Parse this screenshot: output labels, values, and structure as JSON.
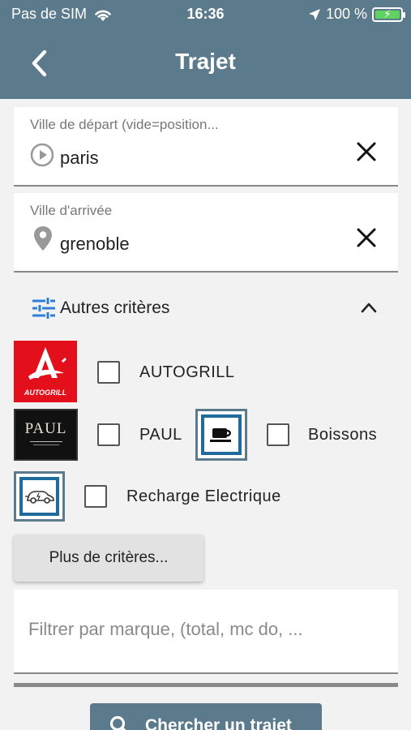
{
  "status_bar": {
    "carrier": "Pas de SIM",
    "time": "16:36",
    "battery": "100 %"
  },
  "header": {
    "title": "Trajet"
  },
  "departure": {
    "label": "Ville de départ (vide=position...",
    "value": "paris"
  },
  "arrival": {
    "label": "Ville d'arrivée",
    "value": "grenoble"
  },
  "criteria": {
    "label": "Autres critères"
  },
  "filters": {
    "autogrill": {
      "label": "AUTOGRILL",
      "logo_text": "AUTOGRILL",
      "checked": false
    },
    "paul": {
      "label": "PAUL",
      "logo_text": "PAUL",
      "checked": false
    },
    "boissons": {
      "label": "Boissons",
      "checked": false
    },
    "recharge": {
      "label": "Recharge Electrique",
      "checked": false
    }
  },
  "more_criteria_label": "Plus de critères...",
  "brand_filter": {
    "placeholder": "Filtrer par marque, (total, mc do, ..."
  },
  "search_button_label": "Chercher un trajet",
  "colors": {
    "primary": "#5b7a8b",
    "accent_blue": "#1e6b9c",
    "autogrill_red": "#e3101b",
    "criteria_icon": "#2f7fd6"
  }
}
